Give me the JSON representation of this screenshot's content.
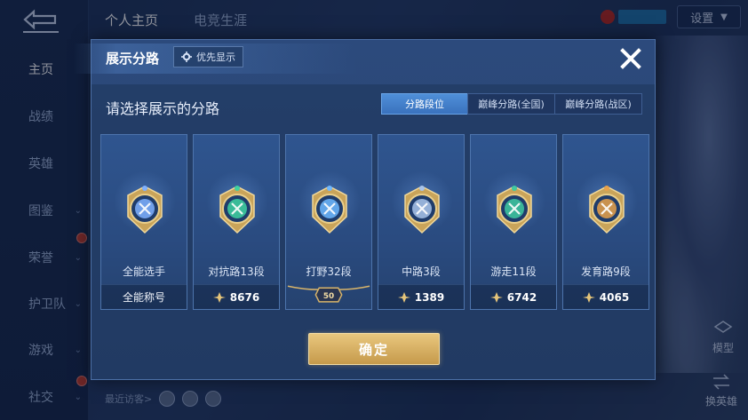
{
  "nav": {
    "items": [
      {
        "label": "主页",
        "active": true,
        "chevron": false
      },
      {
        "label": "战绩",
        "active": false,
        "chevron": false
      },
      {
        "label": "英雄",
        "active": false,
        "chevron": false
      },
      {
        "label": "图鉴",
        "active": false,
        "chevron": true
      },
      {
        "label": "荣誉",
        "active": false,
        "chevron": true
      },
      {
        "label": "护卫队",
        "active": false,
        "chevron": true
      },
      {
        "label": "游戏",
        "active": false,
        "chevron": true
      },
      {
        "label": "社交",
        "active": false,
        "chevron": true
      }
    ]
  },
  "header": {
    "tabs": [
      "个人主页",
      "电竞生涯"
    ],
    "settings_label": "设置"
  },
  "side": {
    "model_label": "模型",
    "change_hero_label": "换英雄"
  },
  "footer": {
    "recent_visitors": "最近访客>"
  },
  "modal": {
    "title": "展示分路",
    "priority_label": "优先显示",
    "prompt": "请选择展示的分路",
    "segments": [
      "分路段位",
      "巅峰分路(全国)",
      "巅峰分路(战区)"
    ],
    "active_segment": 0,
    "cards": [
      {
        "name": "全能选手",
        "points": "",
        "foot_text": "全能称号",
        "emblem": "allround-emblem-icon",
        "color": "#7fb0ff"
      },
      {
        "name": "对抗路13段",
        "points": "8676",
        "foot_text": "",
        "emblem": "clash-lane-emblem-icon",
        "color": "#3fd1a0"
      },
      {
        "name": "打野32段",
        "points": "",
        "foot_text": "",
        "rank_badge": "50",
        "emblem": "jungle-emblem-icon",
        "color": "#6fb8ff"
      },
      {
        "name": "中路3段",
        "points": "1389",
        "foot_text": "",
        "emblem": "mid-lane-emblem-icon",
        "color": "#a9c4ea"
      },
      {
        "name": "游走11段",
        "points": "6742",
        "foot_text": "",
        "emblem": "roam-emblem-icon",
        "color": "#3fc9a0"
      },
      {
        "name": "发育路9段",
        "points": "4065",
        "foot_text": "",
        "emblem": "farm-lane-emblem-icon",
        "color": "#e8a14a"
      }
    ],
    "confirm_label": "确定"
  }
}
